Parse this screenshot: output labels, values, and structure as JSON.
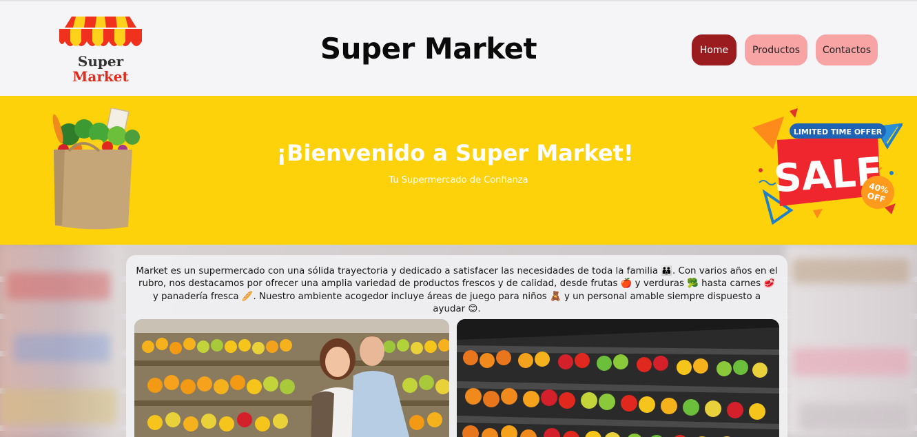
{
  "header": {
    "logo_line1": "Super",
    "logo_line2": "Market",
    "title": "Super Market",
    "nav": [
      {
        "label": "Home",
        "active": true
      },
      {
        "label": "Productos",
        "active": false
      },
      {
        "label": "Contactos",
        "active": false
      }
    ]
  },
  "hero": {
    "title": "¡Bienvenido a Super Market!",
    "subtitle": "Tu Supermercado de Confianza",
    "sale_badge": {
      "top_text": "LIMITED TIME OFFER",
      "main_text": "SALE",
      "discount_line1": "40%",
      "discount_line2": "OFF"
    }
  },
  "about": {
    "text": "Market es un supermercado con una sólida trayectoria y dedicado a satisfacer las necesidades de toda la familia 👪. Con varios años en el rubro, nos destacamos por ofrecer una amplia variedad de productos frescos y de calidad, desde frutas 🍎 y verduras 🥦 hasta carnes 🥩 y panadería fresca 🥖. Nuestro ambiente acogedor incluye áreas de juego para niños 🧸 y un personal amable siempre dispuesto a ayudar 😊."
  },
  "colors": {
    "header_bg": "#f5f5f7",
    "hero_bg": "#fed20a",
    "nav_active": "#9b1c1f",
    "nav_inactive": "#f8a4a4"
  }
}
